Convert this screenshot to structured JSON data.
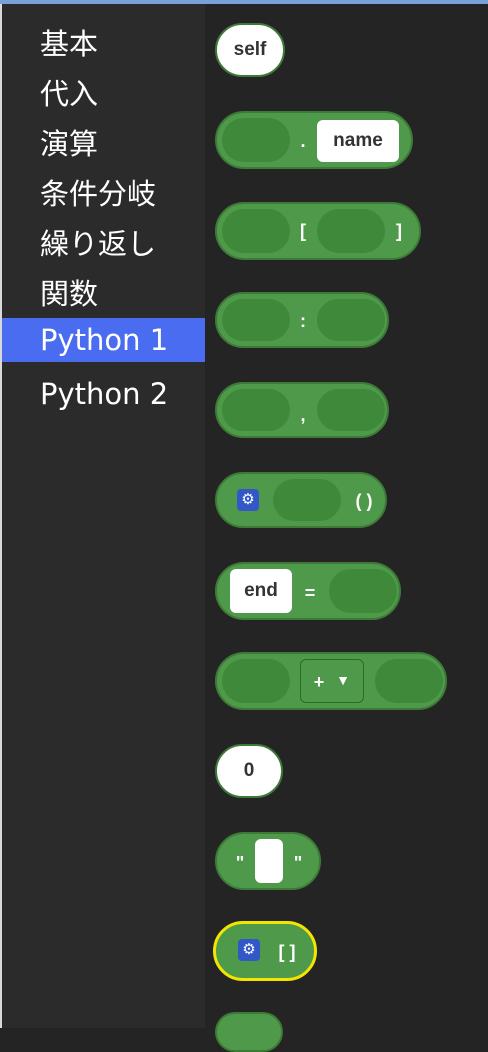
{
  "sidebar": {
    "categories": [
      {
        "label": "基本"
      },
      {
        "label": "代入"
      },
      {
        "label": "演算"
      },
      {
        "label": "条件分岐"
      },
      {
        "label": "繰り返し"
      },
      {
        "label": "関数"
      },
      {
        "label": "Python 1",
        "selected": true
      },
      {
        "label": "Python 2"
      }
    ],
    "selected_color": "#4a6cf0"
  },
  "blocks": {
    "self_label": "self",
    "attribute_dot": ".",
    "attribute_name": "name",
    "index_open": "[",
    "index_close": "]",
    "slice_colon": ":",
    "tuple_comma": ",",
    "call_parens": "( )",
    "keyword_name": "end",
    "keyword_equals": "=",
    "binop_operator": "+",
    "number_value": "0",
    "string_quote_open": "\"",
    "string_quote_close": "\"",
    "list_brackets": "[ ]"
  },
  "colors": {
    "block_green": "#4f9a4a",
    "slot_green": "#3f8a3a",
    "highlight_yellow": "#f2e600",
    "gear_blue": "#3257c8"
  }
}
